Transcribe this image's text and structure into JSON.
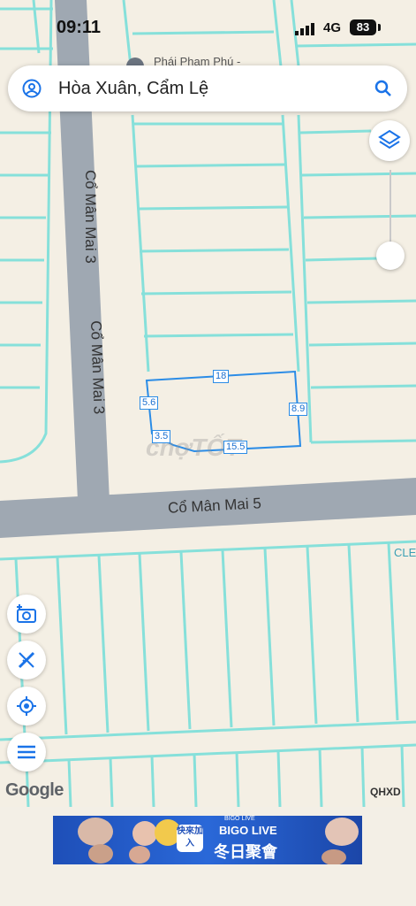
{
  "status_bar": {
    "time": "09:11",
    "network": "4G",
    "battery": "83"
  },
  "search": {
    "text": "Hòa Xuân, Cẩm Lệ"
  },
  "map": {
    "poi_label": "Phái Phạm Phú -",
    "streets": {
      "left_upper": "Cổ Mân Mai 3",
      "left_lower": "Cổ Mân Mai 3",
      "bottom": "Cổ Mân Mai 5"
    },
    "edge_label": "CLE",
    "watermark": "chợTỐT",
    "measurements": {
      "top": "18",
      "left": "5.6",
      "right": "8.9",
      "bottom_left": "3.5",
      "bottom": "15.5"
    }
  },
  "attribution": {
    "google": "Google",
    "qhxd": "QHXD"
  },
  "ad": {
    "brand_top": "BIGO LIVE",
    "title": "BIGO LIVE",
    "subtitle": "冬日聚會",
    "badge": "快來加入"
  },
  "colors": {
    "parcel_lines": "#86e0da",
    "road": "#9fa8b2",
    "measure_line": "#2b8ce6",
    "map_bg": "#f4efe4"
  },
  "icons": [
    "user-icon",
    "search-icon",
    "layers-icon",
    "add-photo-icon",
    "measure-ruler-icon",
    "locate-icon",
    "menu-icon"
  ]
}
